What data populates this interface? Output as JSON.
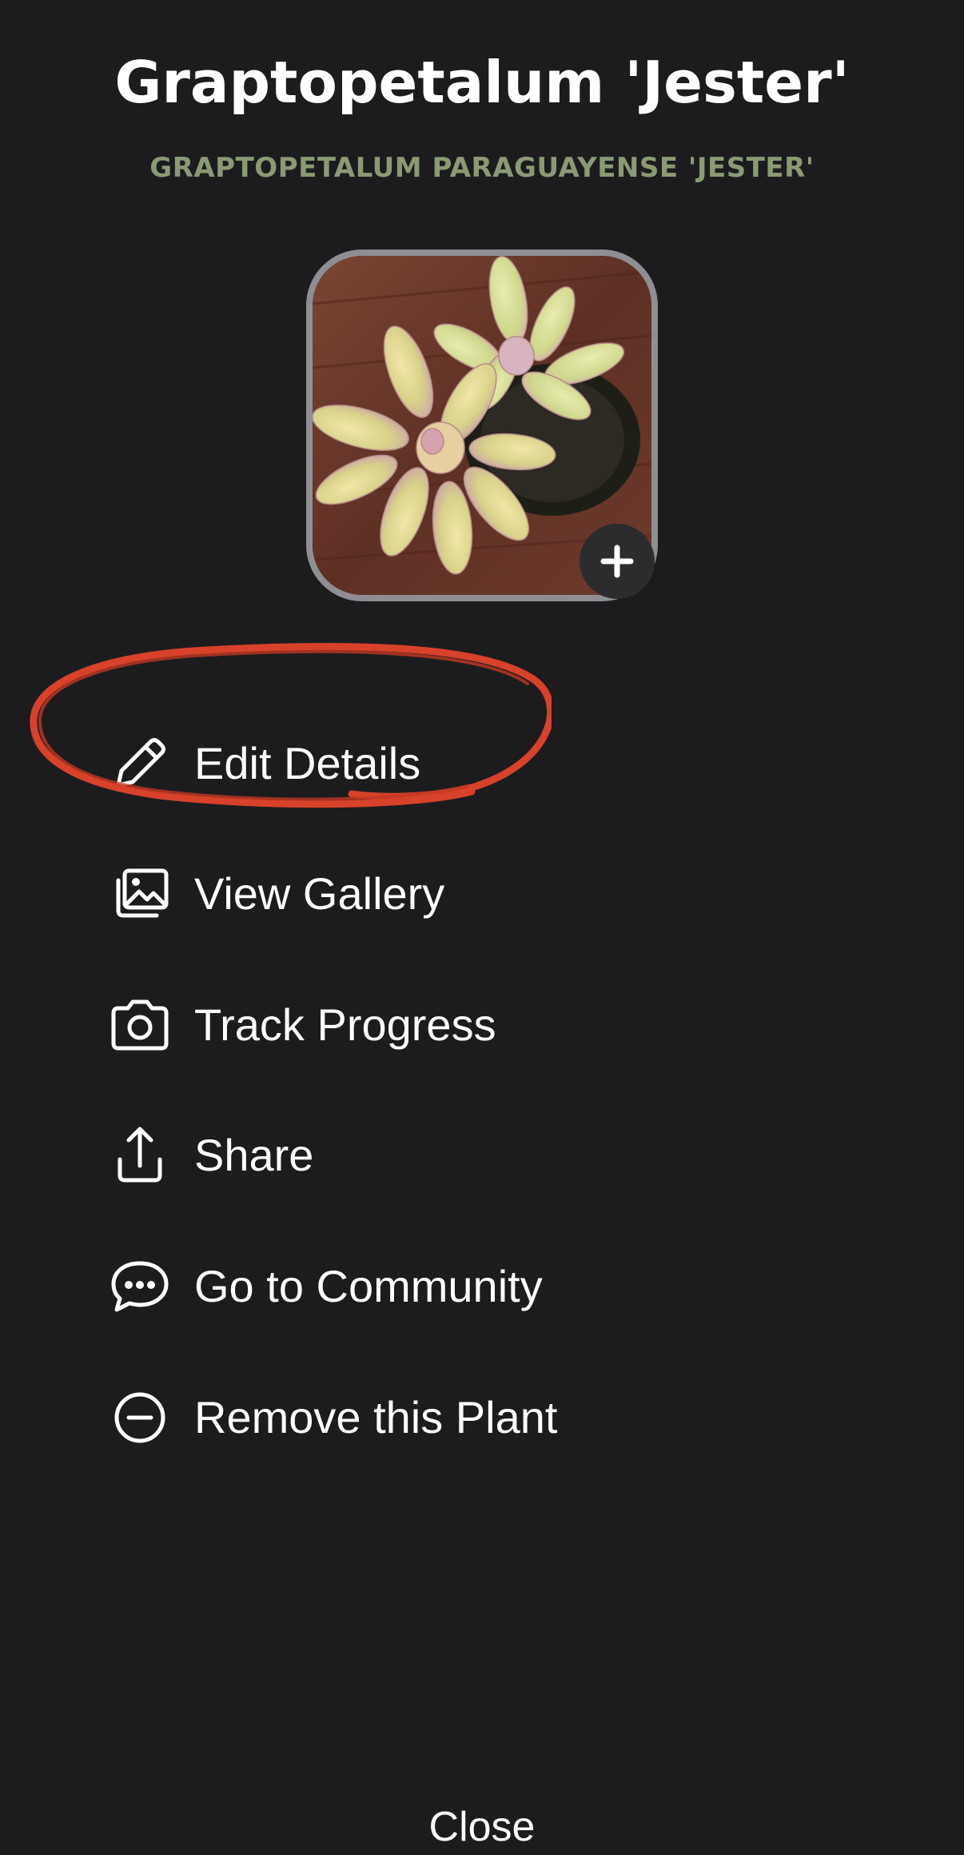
{
  "header": {
    "title": "Graptopetalum 'Jester'",
    "scientific_name": "GRAPTOPETALUM PARAGUAYENSE 'JESTER'",
    "scientific_name_color": "#8a9a74"
  },
  "photo": {
    "icon": "plus-icon"
  },
  "menu": {
    "items": [
      {
        "label": "Edit Details",
        "icon": "pencil-icon"
      },
      {
        "label": "View Gallery",
        "icon": "gallery-icon"
      },
      {
        "label": "Track Progress",
        "icon": "camera-icon"
      },
      {
        "label": "Share",
        "icon": "share-icon"
      },
      {
        "label": "Go to Community",
        "icon": "chat-icon"
      },
      {
        "label": "Remove this Plant",
        "icon": "minus-circle-icon"
      }
    ]
  },
  "annotation": {
    "color": "#d8412a"
  },
  "footer": {
    "close_label": "Close"
  }
}
